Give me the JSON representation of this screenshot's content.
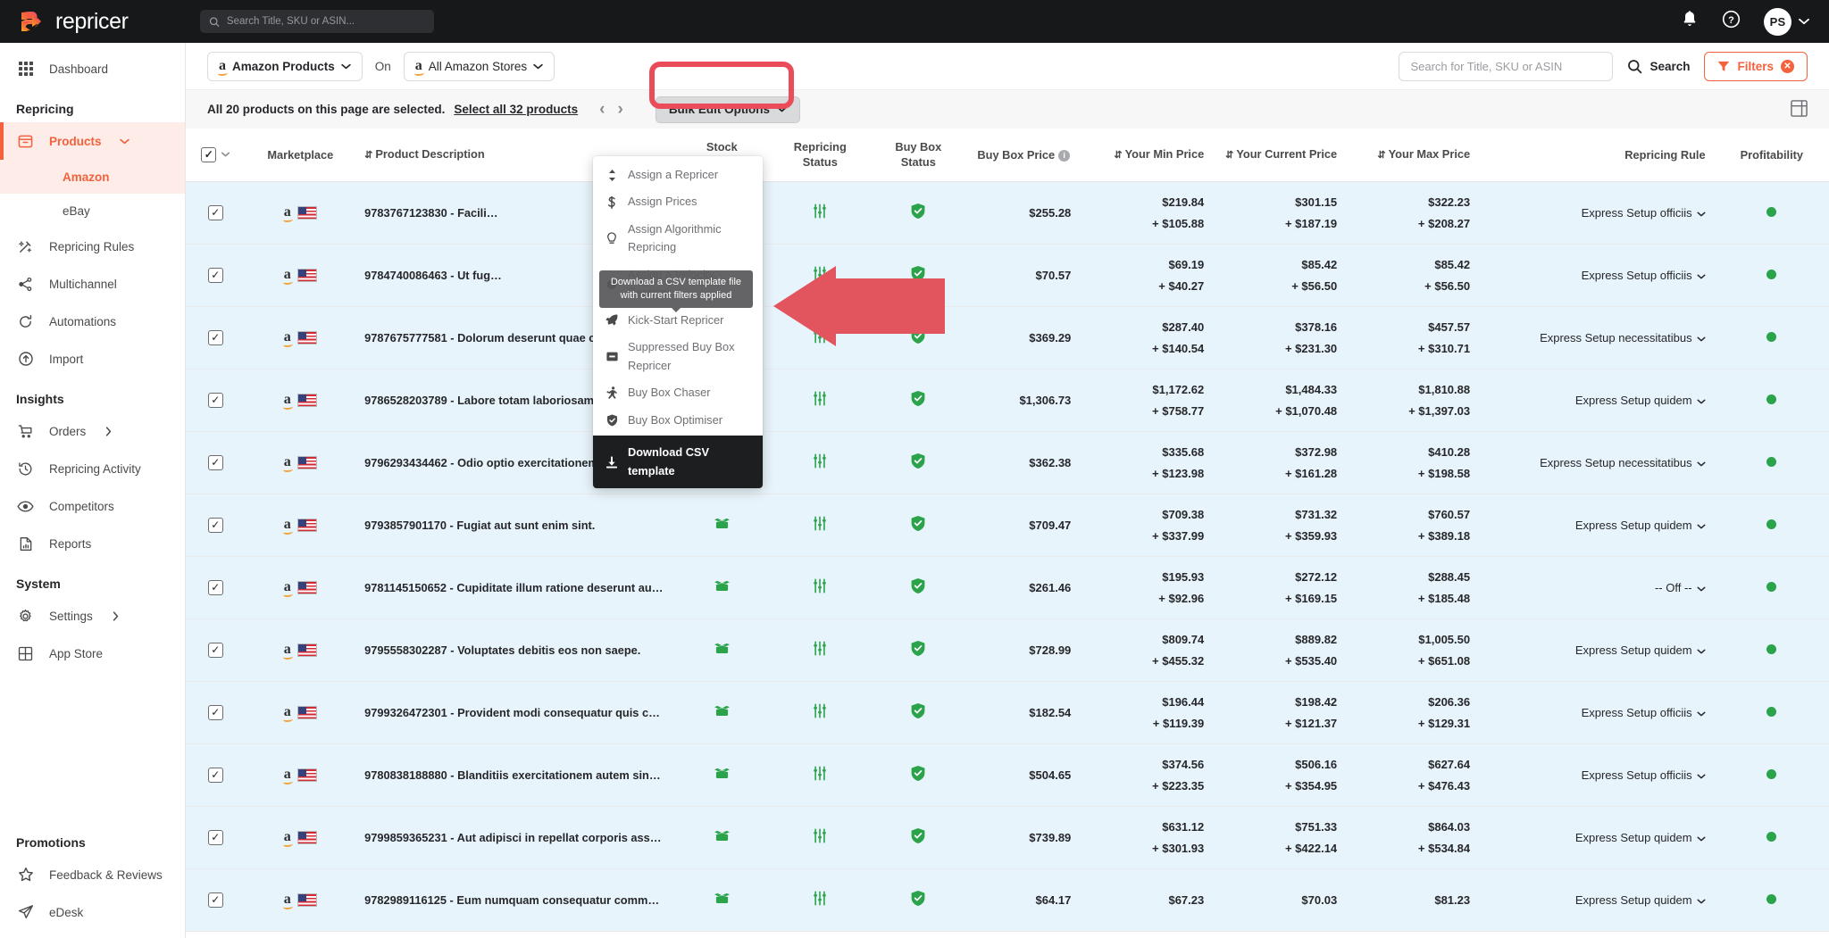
{
  "topbar": {
    "brand": "repricer",
    "search_placeholder": "Search Title, SKU or ASIN...",
    "search_value": "",
    "bell_icon": "bell-icon",
    "help_icon": "help-circle-icon",
    "avatar_initials": "PS"
  },
  "sidebar": {
    "dashboard": "Dashboard",
    "group_repricing": "Repricing",
    "products": "Products",
    "products_sub": [
      "Amazon",
      "eBay"
    ],
    "repricing_rules": "Repricing Rules",
    "multichannel": "Multichannel",
    "automations": "Automations",
    "import": "Import",
    "group_insights": "Insights",
    "orders": "Orders",
    "repricing_activity": "Repricing Activity",
    "competitors": "Competitors",
    "reports": "Reports",
    "group_system": "System",
    "settings": "Settings",
    "app_store": "App Store",
    "group_promotions": "Promotions",
    "feedback_reviews": "Feedback & Reviews",
    "edesk": "eDesk"
  },
  "filterbar": {
    "source_label": "Amazon Products",
    "on_label": "On",
    "store_label": "All Amazon Stores",
    "search_placeholder": "Search for Title, SKU or ASIN",
    "search_value": "",
    "search_button": "Search",
    "filters_button": "Filters",
    "filters_clear": "✕"
  },
  "selectbar": {
    "message": "All 20 products on this page are selected.",
    "select_all_link": "Select all 32 products",
    "prev": "‹",
    "next": "›",
    "bulk_button": "Bulk Edit Options"
  },
  "menu": {
    "items": [
      {
        "label": "Assign a Repricer",
        "icon": "updown-arrows-icon"
      },
      {
        "label": "Assign Prices",
        "icon": "dollar-icon"
      },
      {
        "label": "Assign Algorithmic Repricing",
        "icon": "lightbulb-icon"
      },
      {
        "label": "Assign a Velocity Repricer",
        "icon": "stopwatch-icon"
      },
      {
        "label": "Kick-Start Repricer",
        "icon": "rocket-icon"
      },
      {
        "label": "Suppressed Buy Box Repricer",
        "icon": "minus-box-icon"
      },
      {
        "label": "Buy Box Chaser",
        "icon": "runner-icon"
      },
      {
        "label": "Buy Box Optimiser",
        "icon": "shield-icon"
      }
    ],
    "download_label": "Download CSV template",
    "download_icon": "download-icon",
    "tooltip": "Download a CSV template file with current filters applied"
  },
  "table": {
    "headers": {
      "marketplace": "Marketplace",
      "product_description": "Product Description",
      "stock_availability": "Stock Availability",
      "repricing_status": "Repricing Status",
      "buy_box_status": "Buy Box Status",
      "buy_box_price": "Buy Box Price",
      "your_min_price": "Your Min Price",
      "your_current_price": "Your Current Price",
      "your_max_price": "Your Max Price",
      "repricing_rule": "Repricing Rule",
      "profitability": "Profitability"
    },
    "rows": [
      {
        "checked": true,
        "marketplace": "amazon-us",
        "description": "9783767123830 - Facili…",
        "stock": "in-stock",
        "repricing": "active",
        "buybox": "won",
        "bb_price": "$255.28",
        "min": "$219.84",
        "min_sub": "+ $105.88",
        "cur": "$301.15",
        "cur_sub": "+ $187.19",
        "max": "$322.23",
        "max_sub": "+ $208.27",
        "rule": "Express Setup officiis",
        "profit": "green"
      },
      {
        "checked": true,
        "marketplace": "amazon-us",
        "description": "9784740086463 - Ut fug…",
        "stock": "in-stock",
        "repricing": "active",
        "buybox": "won",
        "bb_price": "$70.57",
        "min": "$69.19",
        "min_sub": "+ $40.27",
        "cur": "$85.42",
        "cur_sub": "+ $56.50",
        "max": "$85.42",
        "max_sub": "+ $56.50",
        "rule": "Express Setup officiis",
        "profit": "green"
      },
      {
        "checked": true,
        "marketplace": "amazon-us",
        "description": "9787675777581 - Dolorum deserunt quae consectetur ma…",
        "stock": "in-stock",
        "repricing": "active",
        "buybox": "won",
        "bb_price": "$369.29",
        "min": "$287.40",
        "min_sub": "+ $140.54",
        "cur": "$378.16",
        "cur_sub": "+ $231.30",
        "max": "$457.57",
        "max_sub": "+ $310.71",
        "rule": "Express Setup necessitatibus",
        "profit": "green"
      },
      {
        "checked": true,
        "marketplace": "amazon-us",
        "description": "9786528203789 - Labore totam laboriosam consequatur …",
        "stock": "in-stock",
        "repricing": "active",
        "buybox": "won",
        "bb_price": "$1,306.73",
        "min": "$1,172.62",
        "min_sub": "+ $758.77",
        "cur": "$1,484.33",
        "cur_sub": "+ $1,070.48",
        "max": "$1,810.88",
        "max_sub": "+ $1,397.03",
        "rule": "Express Setup quidem",
        "profit": "green"
      },
      {
        "checked": true,
        "marketplace": "amazon-us",
        "description": "9796293434462 - Odio optio exercitationem facilis volupt…",
        "stock": "in-stock",
        "repricing": "active",
        "buybox": "won",
        "bb_price": "$362.38",
        "min": "$335.68",
        "min_sub": "+ $123.98",
        "cur": "$372.98",
        "cur_sub": "+ $161.28",
        "max": "$410.28",
        "max_sub": "+ $198.58",
        "rule": "Express Setup necessitatibus",
        "profit": "green"
      },
      {
        "checked": true,
        "marketplace": "amazon-us",
        "description": "9793857901170 - Fugiat aut sunt enim sint.",
        "stock": "in-stock",
        "repricing": "active",
        "buybox": "won",
        "bb_price": "$709.47",
        "min": "$709.38",
        "min_sub": "+ $337.99",
        "cur": "$731.32",
        "cur_sub": "+ $359.93",
        "max": "$760.57",
        "max_sub": "+ $389.18",
        "rule": "Express Setup quidem",
        "profit": "green"
      },
      {
        "checked": true,
        "marketplace": "amazon-us",
        "description": "9781145150652 - Cupiditate illum ratione deserunt autem…",
        "stock": "in-stock",
        "repricing": "active",
        "buybox": "won",
        "bb_price": "$261.46",
        "min": "$195.93",
        "min_sub": "+ $92.96",
        "cur": "$272.12",
        "cur_sub": "+ $169.15",
        "max": "$288.45",
        "max_sub": "+ $185.48",
        "rule": "-- Off --",
        "profit": "green"
      },
      {
        "checked": true,
        "marketplace": "amazon-us",
        "description": "9795558302287 - Voluptates debitis eos non saepe.",
        "stock": "in-stock",
        "repricing": "active",
        "buybox": "won",
        "bb_price": "$728.99",
        "min": "$809.74",
        "min_sub": "+ $455.32",
        "cur": "$889.82",
        "cur_sub": "+ $535.40",
        "max": "$1,005.50",
        "max_sub": "+ $651.08",
        "rule": "Express Setup quidem",
        "profit": "green"
      },
      {
        "checked": true,
        "marketplace": "amazon-us",
        "description": "9799326472301 - Provident modi consequatur quis com…",
        "stock": "in-stock",
        "repricing": "active",
        "buybox": "won",
        "bb_price": "$182.54",
        "min": "$196.44",
        "min_sub": "+ $119.39",
        "cur": "$198.42",
        "cur_sub": "+ $121.37",
        "max": "$206.36",
        "max_sub": "+ $129.31",
        "rule": "Express Setup officiis",
        "profit": "green"
      },
      {
        "checked": true,
        "marketplace": "amazon-us",
        "description": "9780838188880 - Blanditiis exercitationem autem sint qui…",
        "stock": "in-stock",
        "repricing": "active",
        "buybox": "won",
        "bb_price": "$504.65",
        "min": "$374.56",
        "min_sub": "+ $223.35",
        "cur": "$506.16",
        "cur_sub": "+ $354.95",
        "max": "$627.64",
        "max_sub": "+ $476.43",
        "rule": "Express Setup officiis",
        "profit": "green"
      },
      {
        "checked": true,
        "marketplace": "amazon-us",
        "description": "9799859365231 - Aut adipisci in repellat corporis assume…",
        "stock": "in-stock",
        "repricing": "active",
        "buybox": "won",
        "bb_price": "$739.89",
        "min": "$631.12",
        "min_sub": "+ $301.93",
        "cur": "$751.33",
        "cur_sub": "+ $422.14",
        "max": "$864.03",
        "max_sub": "+ $534.84",
        "rule": "Express Setup quidem",
        "profit": "green"
      },
      {
        "checked": true,
        "marketplace": "amazon-us",
        "description": "9782989116125 - Eum numquam consequatur commodi …",
        "stock": "in-stock",
        "repricing": "active",
        "buybox": "won",
        "bb_price": "$64.17",
        "min": "$67.23",
        "min_sub": "",
        "cur": "$70.03",
        "cur_sub": "",
        "max": "$81.23",
        "max_sub": "",
        "rule": "Express Setup quidem",
        "profit": "green"
      }
    ]
  },
  "colors": {
    "accent": "#f4613d",
    "highlight_ring": "#ea4c5a",
    "arrow": "#e2555f",
    "row_bg": "#e8f4fb",
    "green": "#2aa34a"
  }
}
